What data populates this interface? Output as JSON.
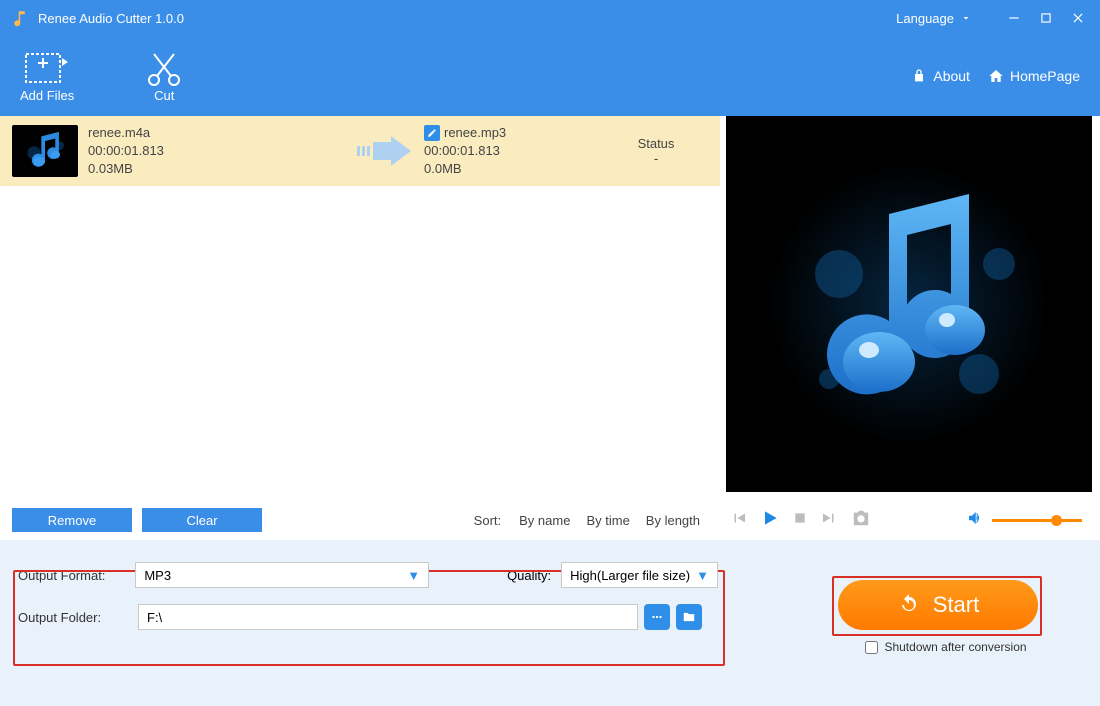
{
  "titlebar": {
    "title": "Renee Audio Cutter 1.0.0",
    "language_label": "Language"
  },
  "toolbar": {
    "add_files": "Add Files",
    "cut": "Cut",
    "about": "About",
    "homepage": "HomePage"
  },
  "file": {
    "src_name": "renee.m4a",
    "src_duration": "00:00:01.813",
    "src_size": "0.03MB",
    "dst_name": "renee.mp3",
    "dst_duration": "00:00:01.813",
    "dst_size": "0.0MB",
    "status_header": "Status",
    "status_value": "-"
  },
  "list": {
    "remove": "Remove",
    "clear": "Clear",
    "sort_label": "Sort:",
    "by_name": "By name",
    "by_time": "By time",
    "by_length": "By length"
  },
  "output": {
    "format_label": "Output Format:",
    "format_value": "MP3",
    "quality_label": "Quality:",
    "quality_value": "High(Larger file size)",
    "folder_label": "Output Folder:",
    "folder_value": "F:\\"
  },
  "start": {
    "button": "Start",
    "shutdown_label": "Shutdown after conversion"
  }
}
